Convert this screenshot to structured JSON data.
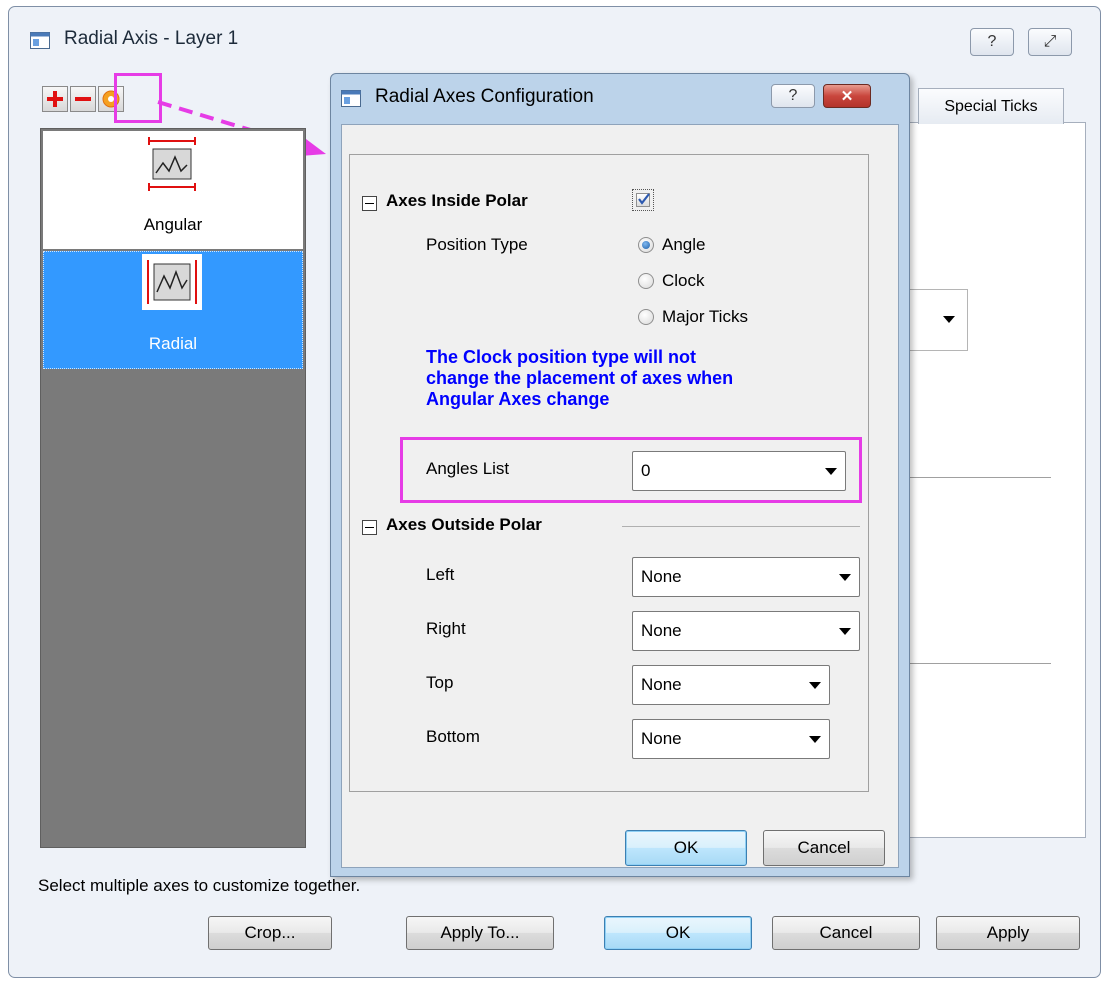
{
  "outer_window": {
    "title": "Radial Axis - Layer 1",
    "help_glyph": "?",
    "close_glyph": "⤢",
    "toolbar": {
      "add_icon": "plus-icon",
      "remove_icon": "minus-icon",
      "config_icon": "circle-config-icon"
    },
    "axis_list": [
      {
        "label": "Angular",
        "selected": false
      },
      {
        "label": "Radial",
        "selected": true
      }
    ],
    "tabs": {
      "special_ticks": "Special Ticks"
    },
    "hint": "Select multiple axes to customize together.",
    "buttons": {
      "crop": "Crop...",
      "apply_to": "Apply To...",
      "ok": "OK",
      "cancel": "Cancel",
      "apply": "Apply"
    }
  },
  "inner_dialog": {
    "title": "Radial Axes Configuration",
    "help_glyph": "?",
    "close_glyph": "✕",
    "axes_inside_polar": {
      "heading": "Axes Inside Polar",
      "checked": true,
      "position_type_label": "Position Type",
      "options": [
        "Angle",
        "Clock",
        "Major Ticks"
      ],
      "selected": "Angle",
      "note_line1": "The Clock position type will not",
      "note_line2": "change the placement of axes when",
      "note_line3": "Angular Axes change",
      "angles_list_label": "Angles List",
      "angles_list_value": "0"
    },
    "axes_outside_polar": {
      "heading": "Axes Outside Polar",
      "left_label": "Left",
      "left_value": "None",
      "right_label": "Right",
      "right_value": "None",
      "top_label": "Top",
      "top_value": "None",
      "bottom_label": "Bottom",
      "bottom_value": "None"
    },
    "buttons": {
      "ok": "OK",
      "cancel": "Cancel"
    }
  },
  "colors": {
    "highlight": "#e63ce6",
    "note_text": "#0000ff",
    "selection": "#3399ff",
    "close_red": "#c9463d"
  }
}
